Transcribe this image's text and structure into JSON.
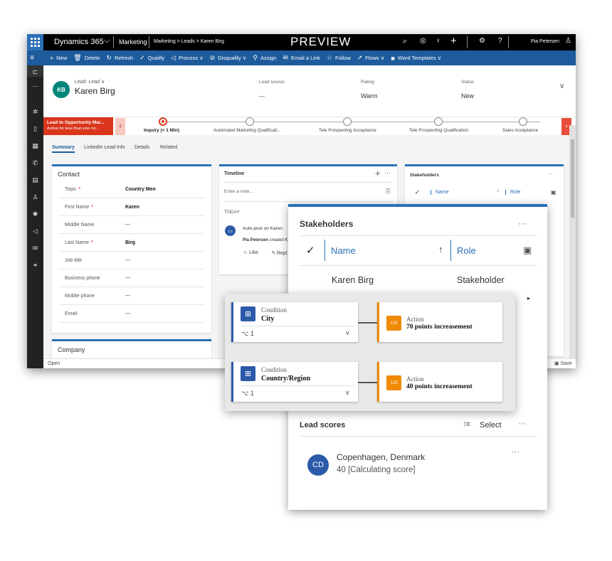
{
  "topbar": {
    "app_name": "Dynamics 365",
    "app_chevron": "⌵",
    "area": "Marketing",
    "breadcrumb": [
      "Marketing",
      "Leads",
      "Karen Birg"
    ],
    "preview_label": "PREVIEW",
    "user": "Pia Petersen"
  },
  "commands": [
    {
      "icon": "+",
      "label": "New"
    },
    {
      "icon": "🗑",
      "label": "Delete"
    },
    {
      "icon": "↻",
      "label": "Refresh"
    },
    {
      "icon": "✓",
      "label": "Qualify"
    },
    {
      "icon": "◁",
      "label": "Process ∨"
    },
    {
      "icon": "⊘",
      "label": "Disqualify ∨"
    },
    {
      "icon": "⚲",
      "label": "Assign"
    },
    {
      "icon": "✉",
      "label": "Email a Link"
    },
    {
      "icon": "☆",
      "label": "Follow"
    },
    {
      "icon": "↗",
      "label": "Flows ∨"
    },
    {
      "icon": "■",
      "label": "Word Templates ∨"
    }
  ],
  "header": {
    "initials": "KB",
    "entity_label": "Lead: Lead ∨",
    "name": "Karen Birg",
    "lead_source_label": "Lead source",
    "lead_source_value": "---",
    "rating_label": "Rating",
    "rating_value": "Warm",
    "status_label": "Status",
    "status_value": "New"
  },
  "bpf": {
    "active_title": "Lead to Opportunity Mar...",
    "active_sub": "Active for less than one mi...",
    "stages": [
      "Inquiry  (< 1 Min)",
      "Automated Marketing Qualificati...",
      "Tele Prospecting Acceptance",
      "Tele Prospecting Qualification",
      "Sales Acceptance"
    ]
  },
  "tabs": [
    "Summary",
    "LinkedIn Lead Info",
    "Details",
    "Related"
  ],
  "contact": {
    "title": "Contact",
    "fields": [
      {
        "label": "Topic",
        "required": true,
        "value": "Country Men"
      },
      {
        "label": "First Name",
        "required": true,
        "value": "Karen"
      },
      {
        "label": "Middle Name",
        "required": false,
        "value": "---"
      },
      {
        "label": "Last Name",
        "required": true,
        "value": "Birg"
      },
      {
        "label": "Job title",
        "required": false,
        "value": "---"
      },
      {
        "label": "Business phone",
        "required": false,
        "value": "---"
      },
      {
        "label": "Mobile phone",
        "required": false,
        "value": "---"
      },
      {
        "label": "Email",
        "required": false,
        "value": "---"
      }
    ]
  },
  "company": {
    "title": "Company"
  },
  "timeline": {
    "title": "Timeline",
    "note_placeholder": "Enter a note...",
    "today_label": "TODAY",
    "post_title": "Auto-post on Karen",
    "post_author": "Pia Petersen",
    "post_text": "created K",
    "like_label": "Like",
    "reply_label": "Repl"
  },
  "stakeholders_small": {
    "title": "Stakeholders",
    "name_col": "Name",
    "role_col": "Role"
  },
  "statusbar": {
    "left": "Open",
    "save": "Save"
  },
  "overlay": {
    "title": "Stakeholders",
    "name_col": "Name",
    "role_col": "Role",
    "row_name": "Karen Birg",
    "row_role": "Stakeholder",
    "lead_scores_title": "Lead scores",
    "select_label": "Select",
    "score_initials": "CD",
    "score_name": "Copenhagen, Denmark",
    "score_value": "40 [Calculating score]"
  },
  "rules": [
    {
      "cond_title": "Condition",
      "cond_value": "City",
      "count": "1",
      "action_title": "Action",
      "action_value": "70 points increasement",
      "badge": "123"
    },
    {
      "cond_title": "Condition",
      "cond_value": "Country/Region",
      "count": "1",
      "action_title": "Action",
      "action_value": "40 points increasement",
      "badge": "123"
    }
  ],
  "colors": {
    "accent": "#2b6fb5",
    "command_bar": "#1d5b9c",
    "bpf_active": "#d9361c",
    "action": "#f08a00",
    "condition": "#2d5aa8",
    "kb_avatar": "#00857a"
  }
}
